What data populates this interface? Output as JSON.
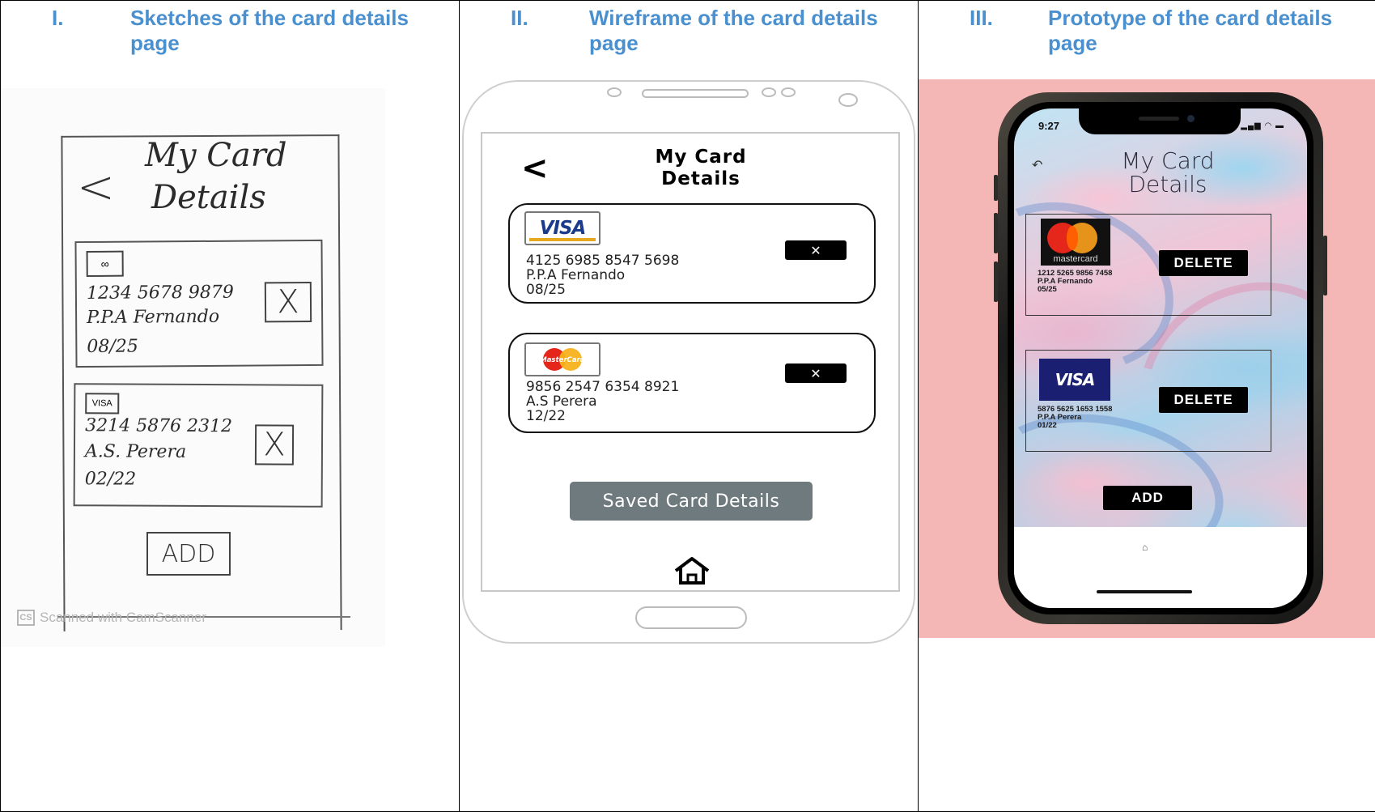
{
  "columns": [
    {
      "numeral": "I.",
      "title": "Sketches of the card details page"
    },
    {
      "numeral": "II.",
      "title": "Wireframe of the card details page"
    },
    {
      "numeral": "III.",
      "title": "Prototype of the card details page"
    }
  ],
  "sketch": {
    "back_glyph": "<",
    "title_line1": "My Card",
    "title_line2": "Details",
    "cards": [
      {
        "logo": "∞",
        "number": "1234 5678 9879",
        "name": "P.P.A Fernando",
        "expiry": "08/25",
        "close": "X"
      },
      {
        "logo": "VISA",
        "number": "3214 5876 2312",
        "name": "A.S. Perera",
        "expiry": "02/22",
        "close": "X"
      }
    ],
    "add_label": "ADD",
    "watermark_logo": "CS",
    "watermark": "Scanned with CamScanner"
  },
  "wireframe": {
    "back_glyph": "<",
    "title_line1": "My Card",
    "title_line2": "Details",
    "cards": [
      {
        "brand": "VISA",
        "number": "4125 6985 8547 5698",
        "name": "P.P.A Fernando",
        "expiry": "08/25",
        "close": "✕"
      },
      {
        "brand": "MasterCard",
        "number": "9856 2547 6354 8921",
        "name": "A.S Perera",
        "expiry": "12/22",
        "close": "✕"
      }
    ],
    "saved_button": "Saved Card Details"
  },
  "prototype": {
    "time": "9:27",
    "status_icons": "▂▄▆ ◠ ▬",
    "back_glyph": "↶",
    "title_line1": "My Card",
    "title_line2": "Details",
    "cards": [
      {
        "brand": "mastercard",
        "number": "1212 5265 9856 7458",
        "name": "P.P.A Fernando",
        "expiry": "05/25",
        "action": "DELETE"
      },
      {
        "brand": "VISA",
        "number": "5876 5625 1653 1558",
        "name": "P.P.A Perera",
        "expiry": "01/22",
        "action": "DELETE"
      }
    ],
    "add_label": "ADD",
    "home_glyph": "⌂"
  },
  "colors": {
    "heading": "#4a90cf",
    "proto_bg": "#f4b7b5",
    "saved_button": "#6f7a7e",
    "visa_blue": "#1a1f71"
  }
}
